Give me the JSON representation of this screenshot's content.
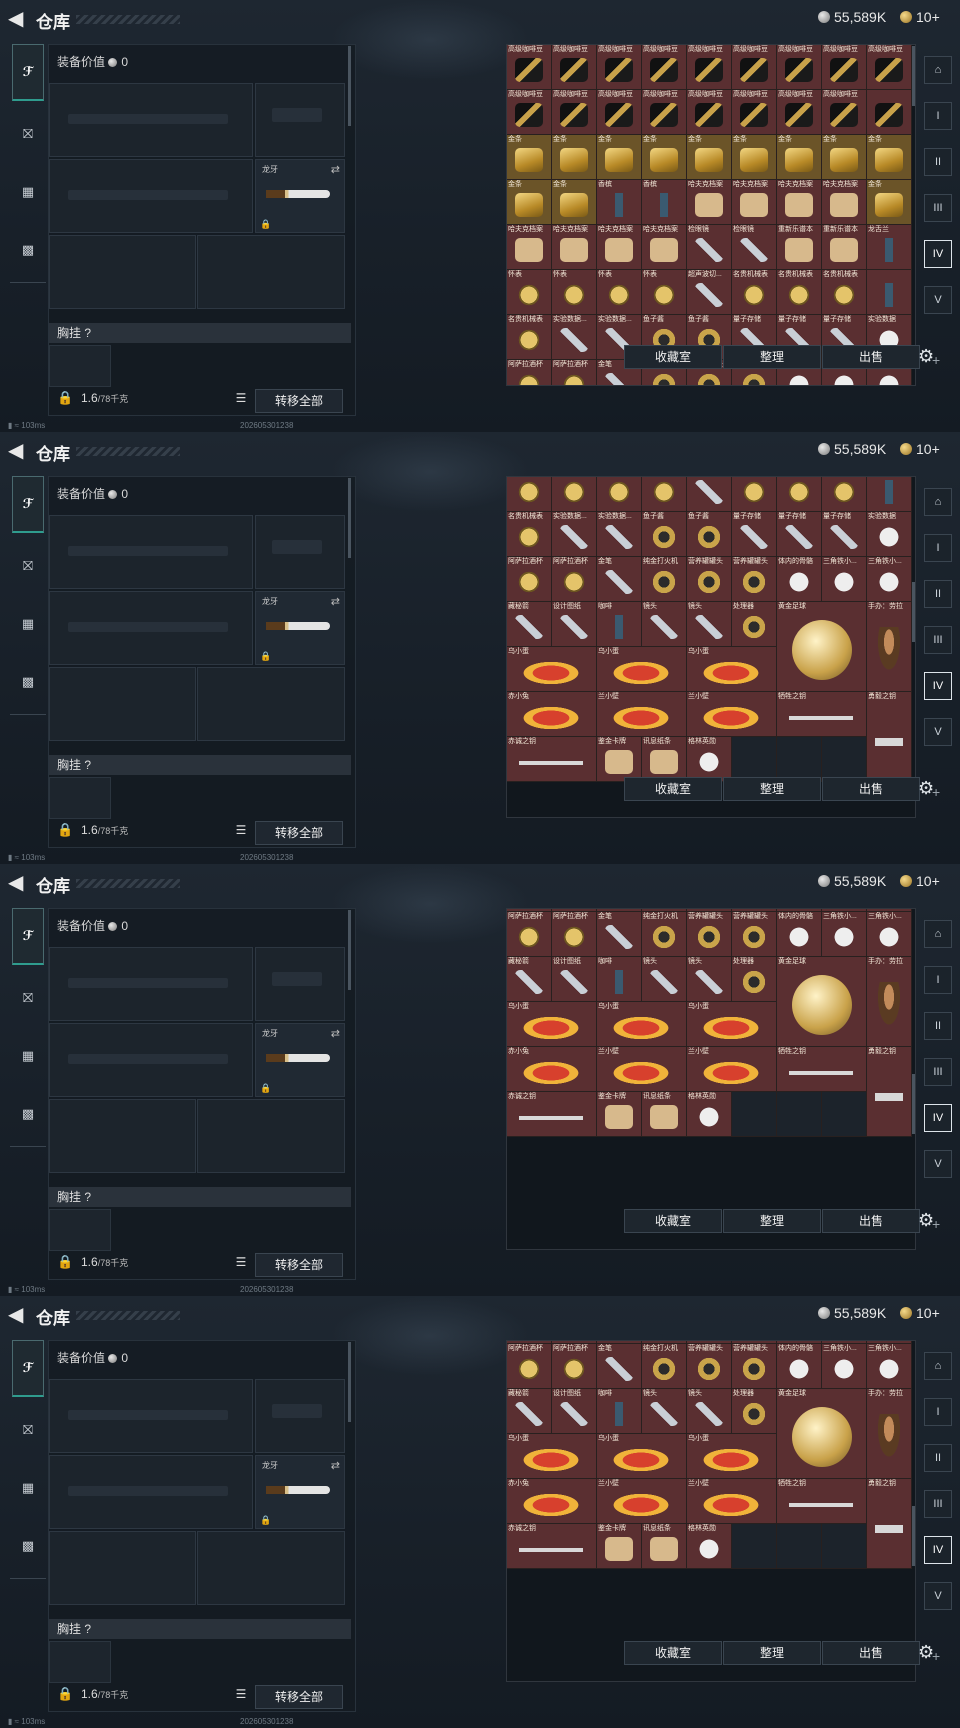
{
  "header": {
    "title": "仓库",
    "currency_silver": "55,589K",
    "currency_gold": "10+"
  },
  "equipment": {
    "value_label": "装备价值",
    "value": "0",
    "knife_label": "龙牙",
    "chest_label": "胸挂",
    "chest_q": "?",
    "weight": "1.6",
    "weight_cap": "/78千克",
    "transfer_all": "转移全部"
  },
  "stash_buttons": {
    "collection": "收藏室",
    "organize": "整理",
    "sell": "出售"
  },
  "status": {
    "ping": "103ms",
    "timestamp": "202605301238"
  },
  "frames": [
    {
      "offset": 0,
      "rows": [
        [
          {
            "l": "高级咖啡豆",
            "t": "coffee"
          },
          {
            "l": "高级咖啡豆",
            "t": "coffee"
          },
          {
            "l": "高级咖啡豆",
            "t": "coffee"
          },
          {
            "l": "高级咖啡豆",
            "t": "coffee"
          },
          {
            "l": "高级咖啡豆",
            "t": "coffee"
          }
        ],
        [
          {
            "l": "高级咖啡豆",
            "t": "coffee"
          },
          {
            "l": "高级咖啡豆",
            "t": "coffee"
          },
          {
            "l": "高级咖啡豆",
            "t": "coffee"
          },
          {
            "l": "高级咖啡豆",
            "t": "coffee"
          }
        ],
        [
          {
            "l": "金条",
            "t": "goldbar"
          },
          {
            "l": "金条",
            "t": "goldbar"
          },
          {
            "l": "金条",
            "t": "goldbar"
          },
          {
            "l": "金条",
            "t": "goldbar"
          },
          {
            "l": "金条",
            "t": "goldbar"
          }
        ],
        [
          {
            "l": "金条",
            "t": "goldbar"
          },
          {
            "l": "香槟",
            "t": "bottle"
          },
          {
            "l": "哈夫克档案",
            "t": "paper"
          },
          {
            "l": "哈夫克档案",
            "t": "paper"
          }
        ],
        [
          {
            "l": "哈夫克档案",
            "t": "paper"
          },
          {
            "l": "哈夫克档案",
            "t": "paper"
          },
          {
            "l": "检眼镜",
            "t": "tool"
          },
          {
            "l": "重新乐谱本",
            "t": "paper"
          },
          {
            "l": "龙舌兰",
            "t": "bottle"
          }
        ],
        [
          {
            "l": "怀表",
            "t": "watch"
          },
          {
            "l": "怀表",
            "t": "watch"
          },
          {
            "l": "怀表",
            "t": "watch"
          },
          {
            "l": "超声波切...",
            "t": "tool"
          },
          {
            "l": "名贵机械表",
            "t": "watch"
          },
          {
            "l": "名贵机械表",
            "t": "watch"
          }
        ],
        [
          {
            "l": "名贵机械表",
            "t": "watch"
          },
          {
            "l": "实验数据...",
            "t": "tool"
          },
          {
            "l": "鱼子酱",
            "t": "tin"
          },
          {
            "l": "量子存储",
            "t": "tool"
          },
          {
            "l": "量子存储",
            "t": "tool"
          },
          {
            "l": "实验数据",
            "t": "disc"
          }
        ],
        [
          {
            "l": "阿萨拉酒杯",
            "t": "watch"
          },
          {
            "l": "阿萨拉酒杯",
            "t": "watch"
          },
          {
            "l": "金笔",
            "t": "tool"
          },
          {
            "l": "纯金打火机",
            "t": "tin"
          },
          {
            "l": "营养罐罐头",
            "t": "tin"
          },
          {
            "l": "体内的骨骼",
            "t": "disc"
          },
          {
            "l": "三角铁小...",
            "t": "disc"
          }
        ]
      ]
    },
    {
      "offset": 1,
      "rows": []
    },
    {
      "offset": 2,
      "rows": []
    },
    {
      "offset": 3,
      "rows": []
    }
  ],
  "bottom_items": [
    [
      {
        "l": "怀表",
        "t": "watch"
      },
      {
        "l": "怀表",
        "t": "watch"
      },
      {
        "l": "怀表",
        "t": "watch"
      },
      {
        "l": "怀表",
        "t": "watch"
      },
      {
        "l": "超声波切...",
        "t": "tool"
      },
      {
        "l": "名贵机械表",
        "t": "watch"
      },
      {
        "l": "名贵机械表",
        "t": "watch"
      },
      {
        "l": "名贵机械表",
        "t": "watch"
      },
      {
        "l": "",
        "t": "bottle"
      }
    ],
    [
      {
        "l": "名贵机械表",
        "t": "watch"
      },
      {
        "l": "实验数据...",
        "t": "tool"
      },
      {
        "l": "实验数据...",
        "t": "tool"
      },
      {
        "l": "鱼子酱",
        "t": "tin"
      },
      {
        "l": "鱼子酱",
        "t": "tin"
      },
      {
        "l": "量子存储",
        "t": "tool"
      },
      {
        "l": "量子存储",
        "t": "tool"
      },
      {
        "l": "量子存储",
        "t": "tool"
      },
      {
        "l": "实验数据",
        "t": "disc"
      }
    ],
    [
      {
        "l": "阿萨拉酒杯",
        "t": "watch"
      },
      {
        "l": "阿萨拉酒杯",
        "t": "watch"
      },
      {
        "l": "金笔",
        "t": "tool"
      },
      {
        "l": "纯金打火机",
        "t": "tin"
      },
      {
        "l": "营养罐罐头",
        "t": "tin"
      },
      {
        "l": "营养罐罐头",
        "t": "tin"
      },
      {
        "l": "体内的骨骼",
        "t": "disc"
      },
      {
        "l": "三角铁小...",
        "t": "disc"
      },
      {
        "l": "三角铁小...",
        "t": "disc"
      }
    ],
    [
      {
        "l": "藏秘箭",
        "t": "tool"
      },
      {
        "l": "设计图纸",
        "t": "tool"
      },
      {
        "l": "咖啡",
        "t": "bottle"
      },
      {
        "l": "镜头",
        "t": "tool"
      },
      {
        "l": "镜头",
        "t": "tool"
      },
      {
        "l": "处理器",
        "t": "tin"
      },
      {
        "l": "黄金足球",
        "t": "ball",
        "big": true
      },
      {
        "l": "手办：劳拉",
        "t": "figure",
        "tall": true
      }
    ],
    [
      {
        "l": "乌小蛋",
        "t": "egg",
        "wide": true
      },
      {
        "l": "乌小蛋",
        "t": "egg",
        "wide": true
      },
      {
        "l": "乌小蛋",
        "t": "egg",
        "wide": true
      }
    ],
    [
      {
        "l": "赤小兔",
        "t": "egg",
        "wide": true
      },
      {
        "l": "兰小壁",
        "t": "egg",
        "wide": true
      },
      {
        "l": "兰小壁",
        "t": "egg",
        "wide": true
      },
      {
        "l": "牺牲之钥",
        "t": "key",
        "wide": true
      },
      {
        "l": "勇毅之钥",
        "t": "key",
        "tall": true
      }
    ],
    [
      {
        "l": "赤诚之钥",
        "t": "key",
        "wide": true
      },
      {
        "l": "鉴金卡牌",
        "t": "paper"
      },
      {
        "l": "讯息纸条",
        "t": "paper"
      },
      {
        "l": "格林英勋",
        "t": "disc"
      },
      {
        "l": "",
        "t": "empty"
      },
      {
        "l": "",
        "t": "empty"
      },
      {
        "l": "",
        "t": "empty"
      }
    ]
  ],
  "icons": {
    "back": "back-arrow-icon",
    "gun": "gun-icon",
    "helmet": "helmet-icon",
    "vest": "vest-icon",
    "bag": "backpack-icon",
    "settings": "gear-icon"
  },
  "colors": {
    "stash_cell": "#5a2f31",
    "empty_cell": "#1c232b",
    "accent": "#2f9c8e"
  }
}
